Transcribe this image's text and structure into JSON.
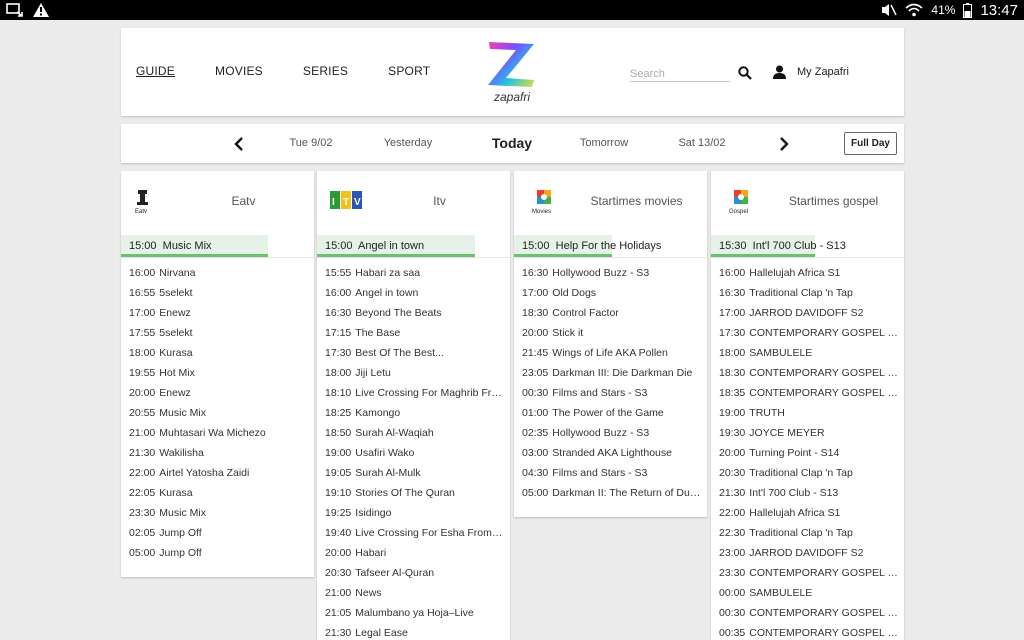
{
  "status_bar": {
    "battery": "41%",
    "time": "13:47"
  },
  "header": {
    "nav": [
      "GUIDE",
      "MOVIES",
      "SERIES",
      "SPORT"
    ],
    "active_nav": "GUIDE",
    "logo_text": "zapafri",
    "search_placeholder": "Search",
    "user_label": "My Zapafri"
  },
  "date_bar": {
    "dates": [
      "Tue 9/02",
      "Yesterday",
      "Today",
      "Tomorrow",
      "Sat 13/02"
    ],
    "selected": "Today",
    "full_day_label": "Full Day"
  },
  "channels": [
    {
      "name": "Eatv",
      "logo_caption": "Eatv",
      "now": {
        "time": "15:00",
        "title": "Music Mix",
        "progress": 0.76
      },
      "programs": [
        [
          "16:00",
          "Nirvana"
        ],
        [
          "16:55",
          "5selekt"
        ],
        [
          "17:00",
          "Enewz"
        ],
        [
          "17:55",
          "5selekt"
        ],
        [
          "18:00",
          "Kurasa"
        ],
        [
          "19:55",
          "Hot Mix"
        ],
        [
          "20:00",
          "Enewz"
        ],
        [
          "20:55",
          "Music Mix"
        ],
        [
          "21:00",
          "Muhtasari Wa Michezo"
        ],
        [
          "21:30",
          "Wakilisha"
        ],
        [
          "22:00",
          "Airtel Yatosha Zaidi"
        ],
        [
          "22:05",
          "Kurasa"
        ],
        [
          "23:30",
          "Music Mix"
        ],
        [
          "02:05",
          "Jump Off"
        ],
        [
          "05:00",
          "Jump Off"
        ]
      ]
    },
    {
      "name": "Itv",
      "logo_caption": "ITV",
      "now": {
        "time": "15:00",
        "title": "Angel in town",
        "progress": 0.82
      },
      "programs": [
        [
          "15:55",
          "Habari za saa"
        ],
        [
          "16:00",
          "Angel in town"
        ],
        [
          "16:30",
          "Beyond The Beats"
        ],
        [
          "17:15",
          "The Base"
        ],
        [
          "17:30",
          "Best Of The Best..."
        ],
        [
          "18:00",
          "Jiji Letu"
        ],
        [
          "18:10",
          "Live Crossing For Maghrib Fro..."
        ],
        [
          "18:25",
          "Kamongo"
        ],
        [
          "18:50",
          "Surah Al-Waqiah"
        ],
        [
          "19:00",
          "Usafiri Wako"
        ],
        [
          "19:05",
          "Surah Al-Mulk"
        ],
        [
          "19:10",
          "Stories Of The Quran"
        ],
        [
          "19:25",
          "Isidingo"
        ],
        [
          "19:40",
          "Live Crossing For Esha From M..."
        ],
        [
          "20:00",
          "Habari"
        ],
        [
          "20:30",
          "Tafseer Al-Quran"
        ],
        [
          "21:00",
          "News"
        ],
        [
          "21:05",
          "Malumbano ya Hoja–Live"
        ],
        [
          "21:30",
          "Legal Ease"
        ]
      ]
    },
    {
      "name": "Startimes movies",
      "logo_caption": "Movies",
      "now": {
        "time": "15:00",
        "title": "Help For the Holidays",
        "progress": 0.51
      },
      "programs": [
        [
          "16:30",
          "Hollywood Buzz - S3"
        ],
        [
          "17:00",
          "Old Dogs"
        ],
        [
          "18:30",
          "Control Factor"
        ],
        [
          "20:00",
          "Stick it"
        ],
        [
          "21:45",
          "Wings of Life AKA Pollen"
        ],
        [
          "23:05",
          "Darkman III: Die Darkman Die"
        ],
        [
          "00:30",
          "Films and Stars - S3"
        ],
        [
          "01:00",
          "The Power of the Game"
        ],
        [
          "02:35",
          "Hollywood Buzz - S3"
        ],
        [
          "03:00",
          "Stranded AKA Lighthouse"
        ],
        [
          "04:30",
          "Films and Stars - S3"
        ],
        [
          "05:00",
          "Darkman II: The Return of Dura..."
        ]
      ]
    },
    {
      "name": "Startimes gospel",
      "logo_caption": "Gospel",
      "now": {
        "time": "15:30",
        "title": "Int'l 700 Club - S13",
        "progress": 0.54
      },
      "programs": [
        [
          "16:00",
          "Hallelujah Africa S1"
        ],
        [
          "16:30",
          "Traditional Clap 'n Tap"
        ],
        [
          "17:00",
          "JARROD DAVIDOFF S2"
        ],
        [
          "17:30",
          "CONTEMPORARY GOSPEL (30)"
        ],
        [
          "18:00",
          "SAMBULELE"
        ],
        [
          "18:30",
          "CONTEMPORARY GOSPEL (30)"
        ],
        [
          "18:35",
          "CONTEMPORARY GOSPEL (30)"
        ],
        [
          "19:00",
          "TRUTH"
        ],
        [
          "19:30",
          "JOYCE MEYER"
        ],
        [
          "20:00",
          "Turning Point - S14"
        ],
        [
          "20:30",
          "Traditional Clap 'n Tap"
        ],
        [
          "21:30",
          "Int'l 700 Club - S13"
        ],
        [
          "22:00",
          "Hallelujah Africa S1"
        ],
        [
          "22:30",
          "Traditional Clap 'n Tap"
        ],
        [
          "23:00",
          "JARROD DAVIDOFF S2"
        ],
        [
          "23:30",
          "CONTEMPORARY GOSPEL (30)"
        ],
        [
          "00:00",
          "SAMBULELE"
        ],
        [
          "00:30",
          "CONTEMPORARY GOSPEL (30)"
        ],
        [
          "00:35",
          "CONTEMPORARY GOSPEL (30)"
        ]
      ]
    }
  ],
  "colors": {
    "now_playing_bg": "#e6f2e7",
    "now_playing_accent": "#6bc16f",
    "page_bg": "#ebebeb"
  }
}
